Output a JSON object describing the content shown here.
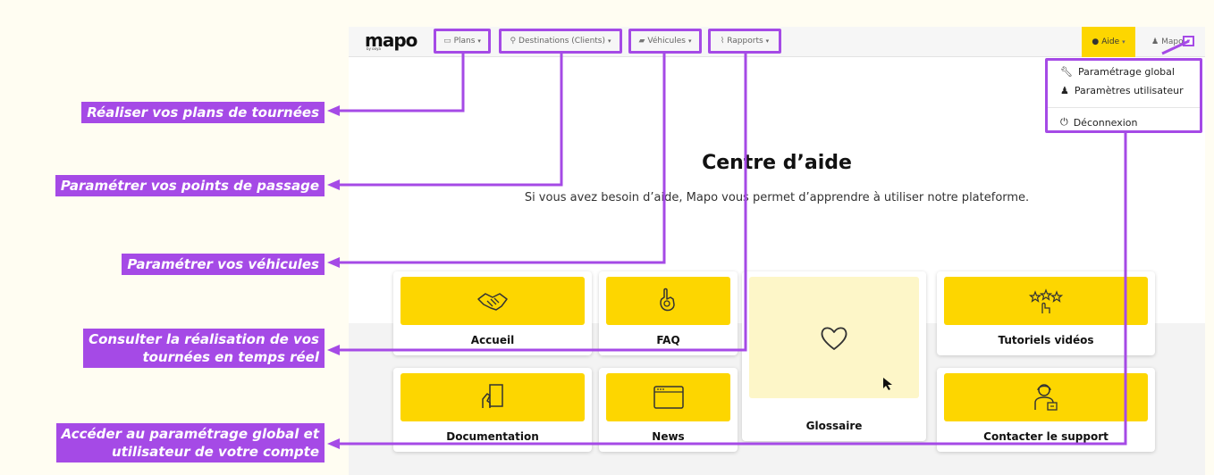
{
  "navbar": {
    "logo": "mapo",
    "logo_sub": "by ooya",
    "items": [
      {
        "label": "Plans",
        "icon": "calendar-icon"
      },
      {
        "label": "Destinations (Clients)",
        "icon": "map-pin-icon"
      },
      {
        "label": "Véhicules",
        "icon": "truck-icon"
      },
      {
        "label": "Rapports",
        "icon": "chart-icon"
      }
    ],
    "aide": "Aide",
    "user": "Mapo"
  },
  "dropdown": {
    "items": [
      "Paramétrage global",
      "Paramètres utilisateur",
      "Déconnexion"
    ]
  },
  "main": {
    "title": "Centre d’aide",
    "subtitle": "Si vous avez besoin d’aide, Mapo vous permet d’apprendre à utiliser notre plateforme."
  },
  "cards": [
    "Accueil",
    "FAQ",
    "Glossaire",
    "Tutoriels vidéos",
    "Documentation",
    "News",
    "Contacter le support"
  ],
  "callouts": {
    "plans": "Réaliser vos plans de tournées",
    "destinations": "Paramétrer vos points de passage",
    "vehicules": "Paramétrer vos véhicules",
    "rapports_line1": "Consulter la réalisation de vos",
    "rapports_line2": "tournées en temps réel",
    "compte_line1": "Accéder au paramétrage global et",
    "compte_line2": "utilisateur de votre compte"
  },
  "colors": {
    "accent_yellow": "#fdd600",
    "annotation_purple": "#a54ae6",
    "glossary_bg": "#fdf6c8"
  }
}
